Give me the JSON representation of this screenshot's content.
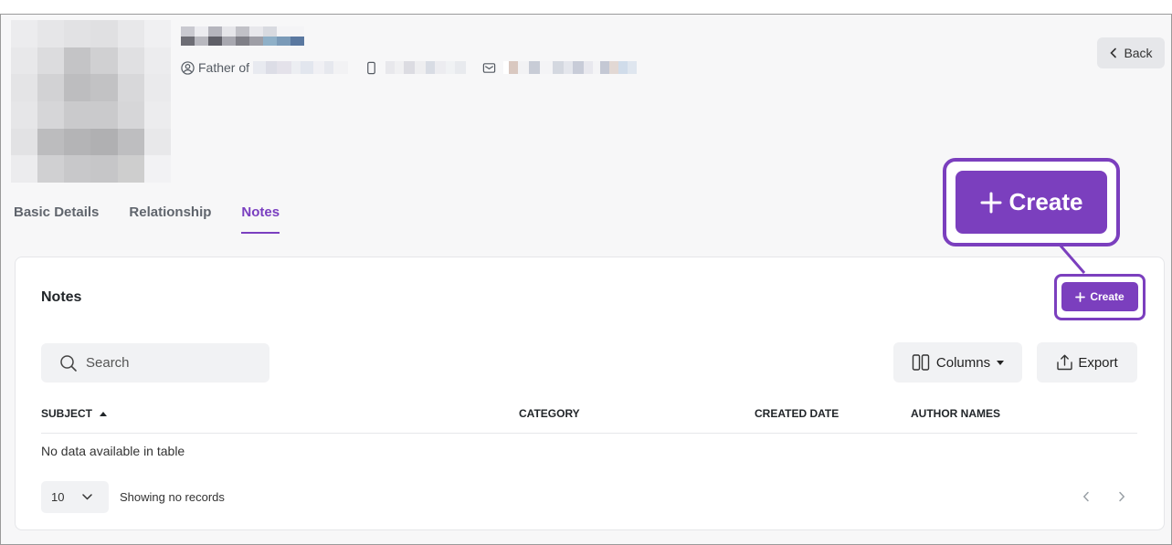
{
  "profile": {
    "relation_label": "Father of"
  },
  "header": {
    "back_label": "Back"
  },
  "tabs": [
    {
      "label": "Basic Details",
      "active": false
    },
    {
      "label": "Relationship",
      "active": false
    },
    {
      "label": "Notes",
      "active": true
    }
  ],
  "notes": {
    "title": "Notes",
    "create_label": "Create",
    "search_placeholder": "Search",
    "columns_label": "Columns",
    "export_label": "Export",
    "table_headers": [
      "SUBJECT",
      "CATEGORY",
      "CREATED DATE",
      "AUTHOR NAMES"
    ],
    "empty_message": "No data available in table",
    "page_size": "10",
    "showing_text": "Showing no records"
  },
  "callout": {
    "label": "Create"
  },
  "colors": {
    "accent": "#7b3fbe",
    "tab_active": "#7a3fc0"
  }
}
